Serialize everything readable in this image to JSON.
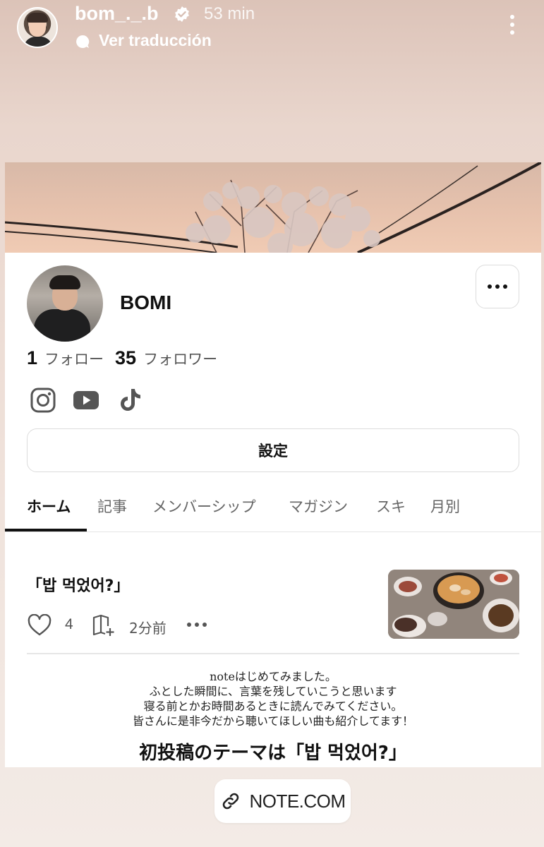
{
  "story": {
    "username": "bom_._.b",
    "time": "53 min",
    "translate_label": "Ver traducción"
  },
  "profile": {
    "name": "BOMI",
    "follow_count": "1",
    "follow_label": "フォロー",
    "follower_count": "35",
    "follower_label": "フォロワー",
    "social_icons": [
      "instagram-icon",
      "youtube-icon",
      "tiktok-icon"
    ],
    "settings_label": "設定"
  },
  "tabs": [
    {
      "label": "ホーム",
      "active": true
    },
    {
      "label": "記事"
    },
    {
      "label": "メンバーシップ"
    },
    {
      "label": "マガジン"
    },
    {
      "label": "スキ"
    },
    {
      "label": "月別"
    }
  ],
  "post": {
    "title": "「밥 먹었어?」",
    "like_count": "4",
    "time": "2分前",
    "body_lines": [
      "noteはじめてみました。",
      "ふとした瞬間に、言葉を残していこうと思います",
      "寝る前とかお時間あるときに読んでみてください。",
      "皆さんに是非今だから聴いてほしい曲も紹介してます！"
    ],
    "heading": "初投稿のテーマは「밥 먹었어?」"
  },
  "link_sticker": {
    "label": "NOTE.COM"
  },
  "colors": {
    "background_top": "#dcc3b8",
    "card": "#ffffff",
    "text_primary": "#111111",
    "text_secondary": "#555555"
  }
}
